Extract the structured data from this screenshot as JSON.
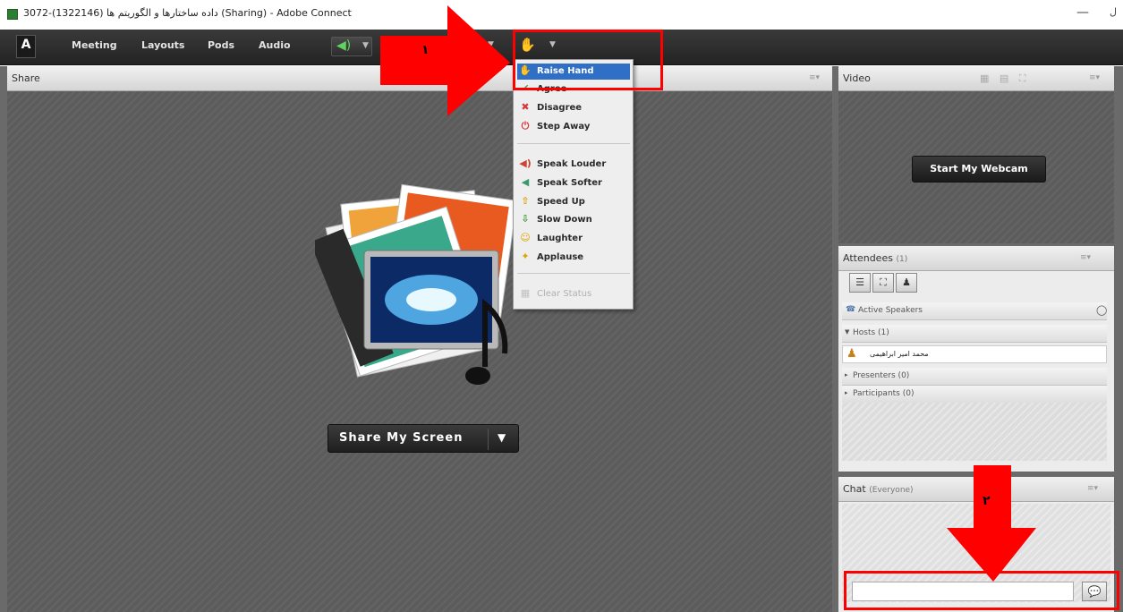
{
  "window": {
    "title": "3072-(1322146) داده ساختارها و الگوریتم ها (Sharing) - Adobe Connect",
    "minimize": "—",
    "close": "ل"
  },
  "menubar": {
    "logo": "A",
    "items": [
      "Meeting",
      "Layouts",
      "Pods",
      "Audio"
    ],
    "speaker_icon": "speaker-icon",
    "status_icon": "raise-hand-icon"
  },
  "share_pod": {
    "title": "Share",
    "menu": "≡▾",
    "button_label": "Share My Screen",
    "button_caret": "▼"
  },
  "status_menu": {
    "items": [
      {
        "label": "Raise Hand",
        "icon": "✋",
        "color": "#ffffff",
        "active": true
      },
      {
        "label": "Agree",
        "icon": "✔",
        "color": "#3fa34d"
      },
      {
        "label": "Disagree",
        "icon": "✖",
        "color": "#d63a3a"
      },
      {
        "label": "Step Away",
        "icon": "⏻",
        "color": "#d63a3a"
      },
      {
        "label": "Speak Louder",
        "icon": "🔊",
        "color": "#c43"
      },
      {
        "label": "Speak Softer",
        "icon": "🔉",
        "color": "#4a8"
      },
      {
        "label": "Speed Up",
        "icon": "⇧",
        "color": "#d9a300"
      },
      {
        "label": "Slow Down",
        "icon": "⇩",
        "color": "#3a9a3a"
      },
      {
        "label": "Laughter",
        "icon": "☺",
        "color": "#e0a100"
      },
      {
        "label": "Applause",
        "icon": "✦",
        "color": "#e0a100"
      },
      {
        "label": "Clear Status",
        "icon": "▦",
        "color": "#c0c0c0",
        "disabled": true
      }
    ]
  },
  "video_pod": {
    "title": "Video",
    "button_label": "Start My Webcam",
    "menu": "≡▾"
  },
  "attendees_pod": {
    "title": "Attendees",
    "count": "(1)",
    "menu": "≡▾",
    "active_speakers": "Active Speakers",
    "hosts": "Hosts (1)",
    "host_user": "محمد امیر ابراهیمی",
    "presenters": "Presenters (0)",
    "participants": "Participants (0)"
  },
  "chat_pod": {
    "title": "Chat",
    "scope": "(Everyone)",
    "menu": "≡▾",
    "input_placeholder": ""
  },
  "annotations": {
    "arrow1_number": "۱",
    "arrow2_number": "۲",
    "color": "#ff0000"
  }
}
